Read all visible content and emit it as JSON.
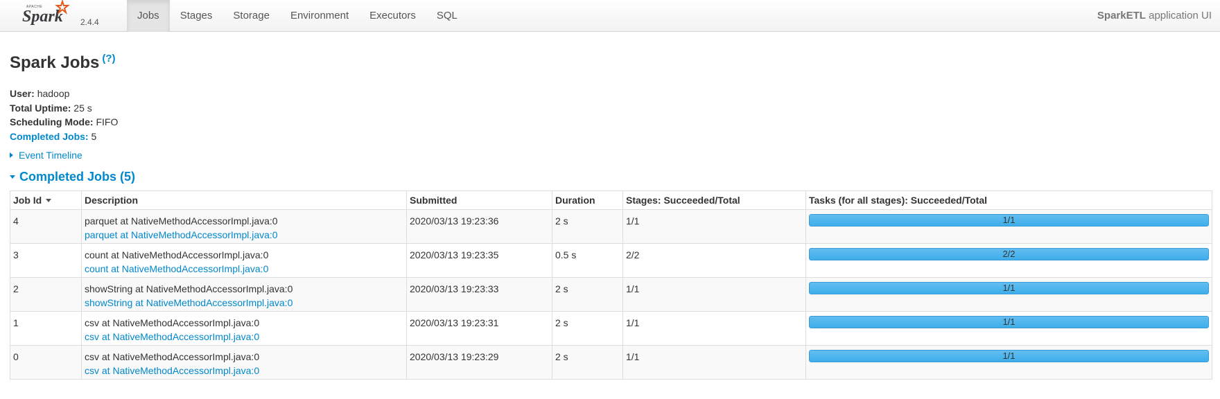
{
  "navbar": {
    "version": "2.4.4",
    "tabs": [
      {
        "label": "Jobs",
        "active": true
      },
      {
        "label": "Stages",
        "active": false
      },
      {
        "label": "Storage",
        "active": false
      },
      {
        "label": "Environment",
        "active": false
      },
      {
        "label": "Executors",
        "active": false
      },
      {
        "label": "SQL",
        "active": false
      }
    ],
    "app_name": "SparkETL",
    "app_suffix": " application UI"
  },
  "page": {
    "title": "Spark Jobs",
    "help": "(?)"
  },
  "summary": {
    "user_label": "User:",
    "user_value": "hadoop",
    "uptime_label": "Total Uptime:",
    "uptime_value": "25 s",
    "mode_label": "Scheduling Mode:",
    "mode_value": "FIFO",
    "completed_label": "Completed Jobs:",
    "completed_value": "5"
  },
  "event_timeline": "Event Timeline",
  "completed_section": "Completed Jobs (5)",
  "table": {
    "headers": {
      "job_id": "Job Id",
      "description": "Description",
      "submitted": "Submitted",
      "duration": "Duration",
      "stages": "Stages: Succeeded/Total",
      "tasks": "Tasks (for all stages): Succeeded/Total"
    },
    "rows": [
      {
        "job_id": "4",
        "desc": "parquet at NativeMethodAccessorImpl.java:0",
        "desc_link": "parquet at NativeMethodAccessorImpl.java:0",
        "submitted": "2020/03/13 19:23:36",
        "duration": "2 s",
        "stages": "1/1",
        "tasks": "1/1",
        "progress": 1.0
      },
      {
        "job_id": "3",
        "desc": "count at NativeMethodAccessorImpl.java:0",
        "desc_link": "count at NativeMethodAccessorImpl.java:0",
        "submitted": "2020/03/13 19:23:35",
        "duration": "0.5 s",
        "stages": "2/2",
        "tasks": "2/2",
        "progress": 1.0
      },
      {
        "job_id": "2",
        "desc": "showString at NativeMethodAccessorImpl.java:0",
        "desc_link": "showString at NativeMethodAccessorImpl.java:0",
        "submitted": "2020/03/13 19:23:33",
        "duration": "2 s",
        "stages": "1/1",
        "tasks": "1/1",
        "progress": 1.0
      },
      {
        "job_id": "1",
        "desc": "csv at NativeMethodAccessorImpl.java:0",
        "desc_link": "csv at NativeMethodAccessorImpl.java:0",
        "submitted": "2020/03/13 19:23:31",
        "duration": "2 s",
        "stages": "1/1",
        "tasks": "1/1",
        "progress": 1.0
      },
      {
        "job_id": "0",
        "desc": "csv at NativeMethodAccessorImpl.java:0",
        "desc_link": "csv at NativeMethodAccessorImpl.java:0",
        "submitted": "2020/03/13 19:23:29",
        "duration": "2 s",
        "stages": "1/1",
        "tasks": "1/1",
        "progress": 1.0
      }
    ]
  },
  "colors": {
    "link": "#0088cc",
    "progress_fill": "#4ab3ec",
    "logo_orange": "#e25a1c"
  }
}
